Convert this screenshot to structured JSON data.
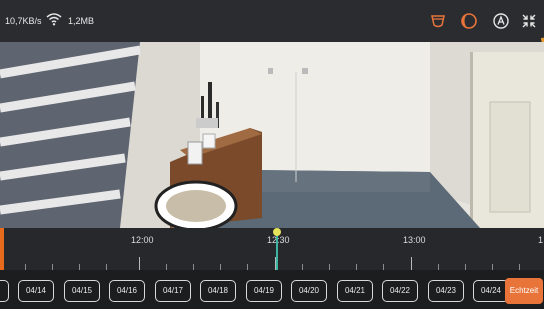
{
  "status": {
    "speed": "10,7KB/s",
    "data_size": "1,2MB"
  },
  "toolbar": {
    "icons": [
      "ptz-icon",
      "night-mode-icon",
      "auto-mode-icon",
      "shrink-icon"
    ]
  },
  "timeline": {
    "labels": [
      "12:00",
      "12:30",
      "13:00",
      "1"
    ]
  },
  "dates": {
    "items": [
      "04/14",
      "04/15",
      "04/16",
      "04/17",
      "04/18",
      "04/19",
      "04/20",
      "04/21",
      "04/22",
      "04/23",
      "04/24"
    ],
    "live_label": "Echtzeit"
  },
  "colors": {
    "accent": "#e8743a",
    "cursor": "#3cb5a0"
  }
}
